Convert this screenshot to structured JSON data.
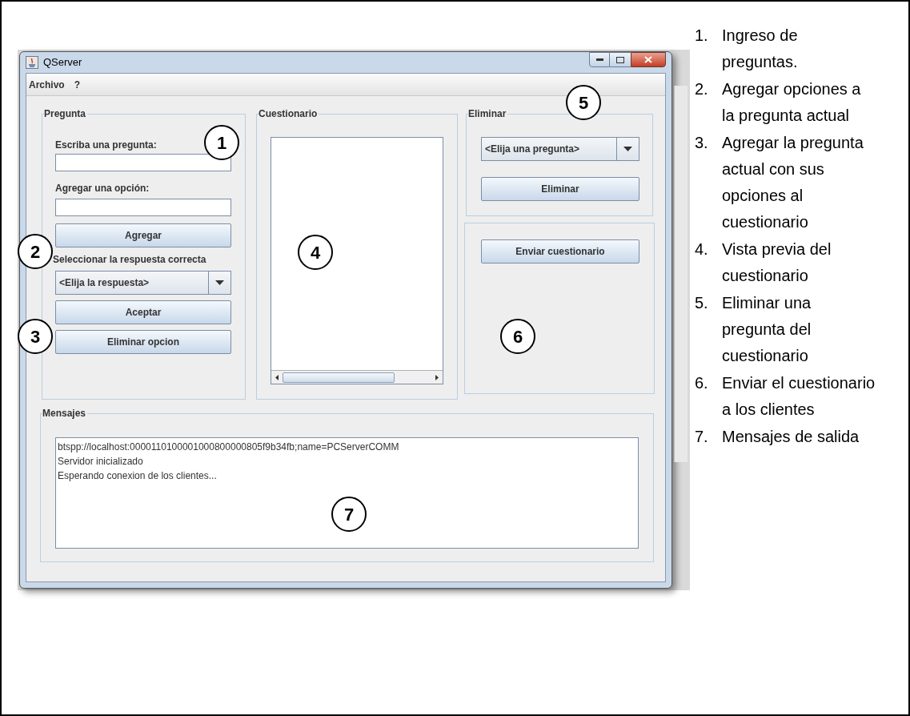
{
  "window": {
    "title": "QServer",
    "menu": [
      "Archivo",
      "?"
    ]
  },
  "pregunta": {
    "title": "Pregunta",
    "question_label": "Escriba una pregunta:",
    "option_label": "Agregar una opción:",
    "add_button": "Agregar",
    "select_label": "Seleccionar la respuesta correcta",
    "answer_dropdown": "<Elija la respuesta>",
    "accept_button": "Aceptar",
    "delete_option_button": "Eliminar opcion"
  },
  "cuestionario": {
    "title": "Cuestionario"
  },
  "eliminar": {
    "title": "Eliminar",
    "dropdown": "<Elija una pregunta>",
    "button": "Eliminar"
  },
  "enviar": {
    "button": "Enviar cuestionario"
  },
  "mensajes": {
    "title": "Mensajes",
    "lines": [
      "btspp://localhost:0000110100001000800000805f9b34fb;name=PCServerCOMM",
      "Servidor inicializado",
      "Esperando conexion de los clientes..."
    ]
  },
  "callouts": [
    "1",
    "2",
    "3",
    "4",
    "5",
    "6",
    "7"
  ],
  "legend": [
    {
      "number": "1.",
      "text": "Ingreso de preguntas."
    },
    {
      "number": "2.",
      "text": "Agregar opciones a la pregunta actual"
    },
    {
      "number": "3.",
      "text": "Agregar la pregunta actual con sus opciones al cuestionario"
    },
    {
      "number": "4.",
      "text": "Vista previa del cuestionario"
    },
    {
      "number": "5.",
      "text": "Eliminar una pregunta del cuestionario"
    },
    {
      "number": "6.",
      "text": "Enviar el cuestionario a los clientes"
    },
    {
      "number": "7.",
      "text": "Mensajes de salida"
    }
  ]
}
